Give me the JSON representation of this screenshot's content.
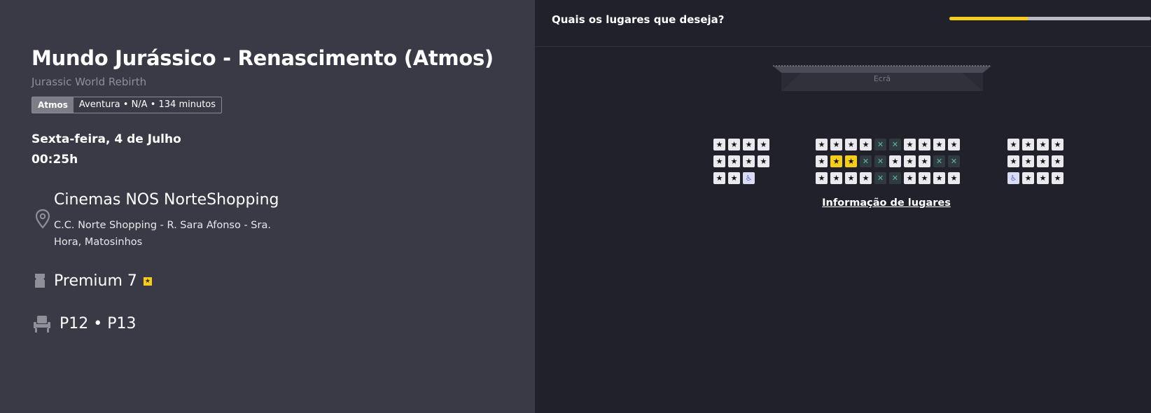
{
  "movie": {
    "title": "Mundo Jurássico - Renascimento (Atmos)",
    "original_title": "Jurassic World Rebirth",
    "format": "Atmos",
    "info": "Aventura • N/A • 134 minutos"
  },
  "session": {
    "date": "Sexta-feira, 4 de Julho",
    "time": "00:25h"
  },
  "cinema": {
    "name": "Cinemas NOS NorteShopping",
    "address": "C.C. Norte Shopping - R. Sara Afonso - Sra. Hora, Matosinhos",
    "room": "Premium 7"
  },
  "selected_seats": "P12 • P13",
  "seat_map": {
    "question": "Quais os lugares que deseja?",
    "screen_label": "Ecrã",
    "info_link": "Informação de lugares",
    "progress": 0.39,
    "rows": [
      {
        "left": [
          "available",
          "available",
          "available",
          "available"
        ],
        "center": [
          "available",
          "available",
          "available",
          "available",
          "occupied",
          "occupied",
          "available",
          "available",
          "available",
          "available"
        ],
        "right": [
          "available",
          "available",
          "available",
          "available"
        ]
      },
      {
        "left": [
          "available",
          "available",
          "available",
          "available"
        ],
        "center": [
          "available",
          "selected",
          "selected",
          "occupied",
          "occupied",
          "available",
          "available",
          "available",
          "occupied",
          "occupied"
        ],
        "right": [
          "available",
          "available",
          "available",
          "available"
        ]
      },
      {
        "left": [
          "available",
          "available",
          "accessible"
        ],
        "center": [
          "available",
          "available",
          "available",
          "available",
          "occupied",
          "occupied",
          "available",
          "available",
          "available",
          "available"
        ],
        "right": [
          "accessible",
          "available",
          "available",
          "available"
        ]
      }
    ]
  },
  "icons": {
    "location": "location-pin-icon",
    "room": "ticket-icon",
    "seat": "seat-icon"
  },
  "colors": {
    "accent": "#f7cd17",
    "left_panel": "#393a45",
    "right_panel": "#20212b"
  }
}
